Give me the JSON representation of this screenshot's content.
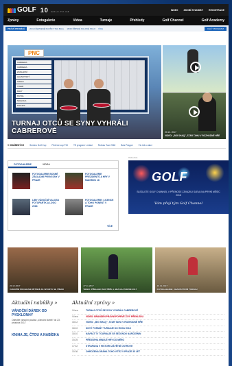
{
  "header": {
    "brand": "GOLF",
    "channel_logo": "10",
    "channel_sub": "GOLF.TV.CZ",
    "links": [
      "INDEX",
      "ZDOBÍ STANDBY",
      "REGISTRACE"
    ]
  },
  "nav": [
    "Zprávy",
    "Fotogalerie",
    "Videa",
    "Turnaje",
    "Přehledy",
    "Golf Channel",
    "Golf Academy"
  ],
  "ticker": {
    "tag": "PRÁVĚ PROBÍHÁ",
    "items": [
      "20:10 ČERVENÉ PLOŠKY TAU BALL",
      "18:00 ŘÍMSKÉ KULOVÉ SKLO"
    ],
    "more": "VÍCE",
    "button": "CELÝ PROGRAM"
  },
  "hero": {
    "caption": "TURNAJ OTCŮ SE SYNY VYHRÁLI CABREROVÉ",
    "sponsor": "PNC",
    "board_rows": [
      "CABRERA",
      "CABRERA",
      "ZAKLADNÍ",
      "LEHNOVSKÝ",
      "SINGH",
      "TIGER",
      "DALY",
      "DUVAL",
      "NICHOLS",
      "PHILIPS"
    ]
  },
  "side": [
    {
      "date": "",
      "title": ""
    },
    {
      "date": "20.12. 2017",
      "title": "VIDEO: „BIG SHAQ\", STAR TAHU V ROZHODNÉ HŘE"
    }
  ],
  "zlinks": {
    "label": "V OBLÍBENÝCH",
    "items": [
      "Semino Golf Cup",
      "Pink Ice cup FIG",
      "TE program v relaci",
      "Rohrau Tour 2018",
      "Bolz Prague",
      "Víc info o akci"
    ]
  },
  "tabs": {
    "items": [
      "FOTOGALERIE",
      "VIDEA"
    ],
    "more": "VÍCE",
    "list": [
      "FOTOGALERIE BOSNÉ ZÁKLADNÍ PRVNÍ DNY V PRAZE",
      "FOTOGALERIE PREZIDENTŮ A HRY V MADRIDU 18",
      "LIBY VÁNOČNÍ VALOSU FOTOPARTK A LOGO 2018",
      "FOTOGALERIE: LICENCE A TOHO PONENT V PRAZE"
    ]
  },
  "ad": {
    "label": "REKLAMA",
    "logo": "GOLF",
    "text": "SLEDUJTE GOLF CHANNEL V PŘENOSE ZÁVAZKU SLEVA NA PRVNÍ MĚSÍC 2018",
    "sub": "Vám přejí tým Golf Channel"
  },
  "cards": [
    {
      "date": "20.12.2017",
      "title": "VÁNOČNÍ PROGRAM DĚTSKÉ ZE SPORTU SE VŠEMI"
    },
    {
      "date": "27.11.2017",
      "title": "VIDEO: PŘEHLED SOUTĚŽE A HRA NA PODZIM 2017"
    },
    {
      "date": "16.11.2017",
      "title": "FOTOGALERIE: CHARITATIVNÍ TURNAJ"
    }
  ],
  "bottom": {
    "left_title": "Aktuální nabídky »",
    "left_items": [
      {
        "h": "VÁNOČNÍ DÁREK OD PYSKLONHY",
        "p": "Odeslíte vánoční poukaz „Vánoční dárek“ do 23. prosince 2017"
      },
      {
        "h": "KNIHA JE, ČTOU A NABÍDKA",
        "p": ""
      }
    ],
    "right_title": "Aktuální zprávy »",
    "news": [
      {
        "t": "Včera",
        "x": "TURNAJ OTCŮ SE SYNY VYHRÁLI CABREROVÉ",
        "hot": false
      },
      {
        "t": "Včera",
        "x": "VIDEO: BRANDEN PRÁVNÍ POPRVÉ ŽIVÝ PŘEKLEDU",
        "hot": true
      },
      {
        "t": "18:12",
        "x": "VIDEO: „BIG SHAQ\", STAR TAHU V ROZHODNÉ HŘE",
        "hot": false
      },
      {
        "t": "18:10",
        "x": "NOVÝ FORMÁT TURNAJE DO ROKU 2018",
        "hot": false
      },
      {
        "t": "18:10",
        "x": "NAVRAT TV TOURNAJE SE SEZONOU NAROZENIN",
        "hot": false
      },
      {
        "t": "15:25",
        "x": "PŘEDSEHA MINULÉ HRY DO MÉRO",
        "hot": false
      },
      {
        "t": "17:42",
        "x": "STRAPANA V HISTORII ZÁVĚTNÍ OSTROVE",
        "hot": false
      },
      {
        "t": "15:36",
        "x": "OHROZENA DRÁHA TOHO VÍTEZ V PRAZE 35 LET",
        "hot": false
      }
    ]
  },
  "colors": {
    "accent": "#1a4f98",
    "hot": "#d0021b",
    "bg": "#0b3169"
  }
}
